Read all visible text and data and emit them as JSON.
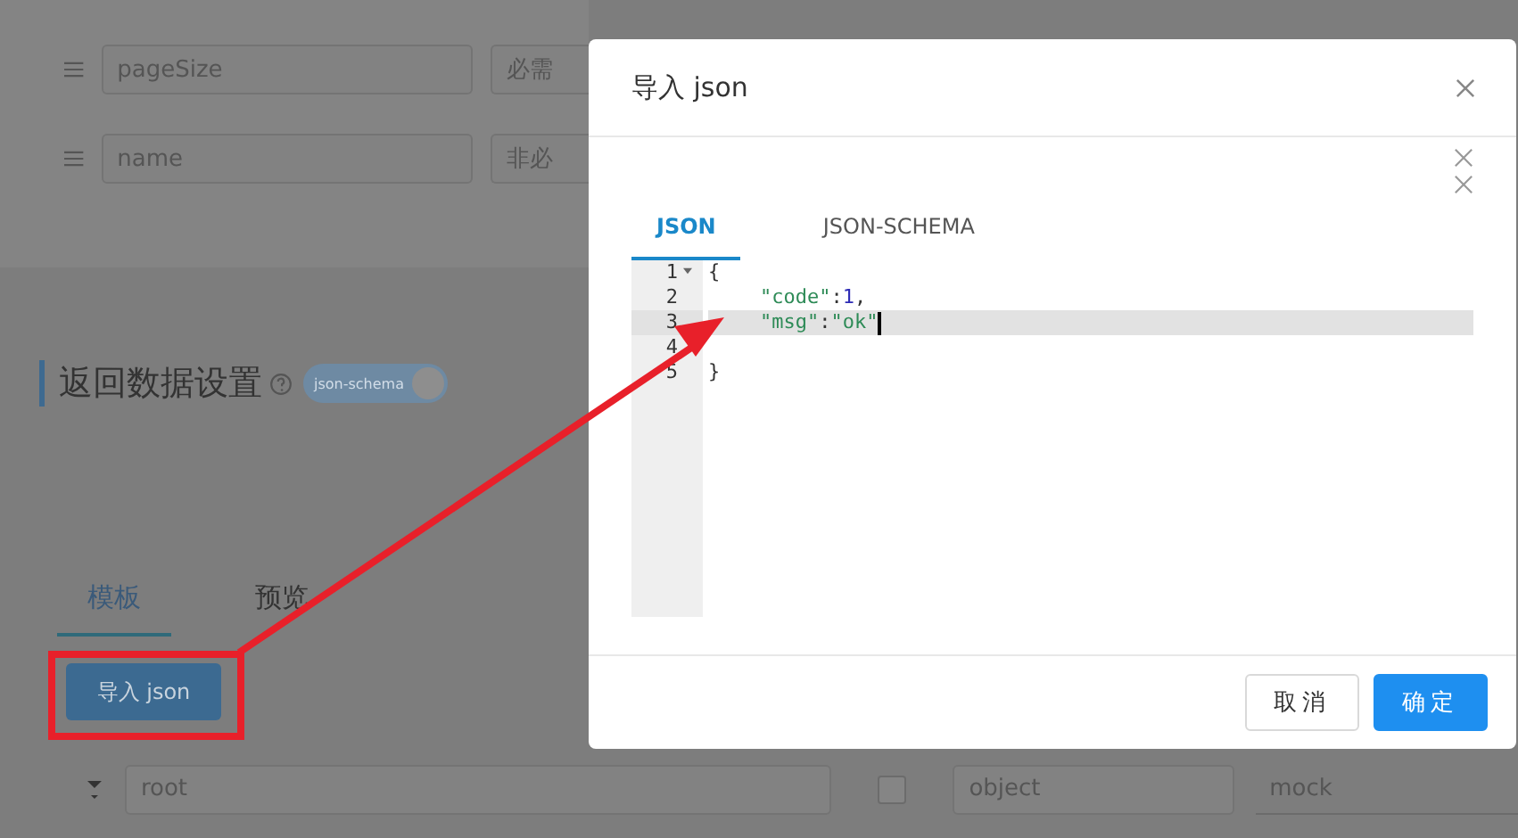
{
  "param_rows": [
    {
      "name": "pageSize",
      "required": "必需"
    },
    {
      "name": "name",
      "required": "非必"
    }
  ],
  "section": {
    "title": "返回数据设置",
    "toggle": {
      "label": "json-schema",
      "on": true
    }
  },
  "tabs": [
    {
      "label": "模板",
      "selected": true
    },
    {
      "label": "预览",
      "selected": false
    }
  ],
  "import_button": "导入 json",
  "schema_row": {
    "name": "root",
    "checked": false,
    "type": "object",
    "mock": "mock"
  },
  "dialog": {
    "title": "导入 json",
    "tabs": [
      {
        "label": "JSON",
        "selected": true
      },
      {
        "label": "JSON-SCHEMA",
        "selected": false
      }
    ],
    "code_lines": [
      {
        "number": "1",
        "fold": true,
        "active": false,
        "indented": false,
        "tokens": [
          {
            "kind": "plain",
            "text": "{"
          }
        ]
      },
      {
        "number": "2",
        "fold": false,
        "active": false,
        "indented": true,
        "tokens": [
          {
            "kind": "string",
            "text": "\"code\""
          },
          {
            "kind": "plain",
            "text": ":"
          },
          {
            "kind": "number",
            "text": "1"
          },
          {
            "kind": "plain",
            "text": ","
          }
        ]
      },
      {
        "number": "3",
        "fold": false,
        "active": true,
        "indented": true,
        "tokens": [
          {
            "kind": "string",
            "text": "\"msg\""
          },
          {
            "kind": "plain",
            "text": ":"
          },
          {
            "kind": "string",
            "text": "\"ok\""
          }
        ]
      },
      {
        "number": "4",
        "fold": false,
        "active": false
      },
      {
        "number": "5",
        "fold": false,
        "active": false,
        "indented": false,
        "tokens": [
          {
            "kind": "plain",
            "text": "}"
          }
        ]
      }
    ],
    "buttons": [
      {
        "label": "取消",
        "kind": "default"
      },
      {
        "label": "确定",
        "kind": "primary"
      }
    ]
  }
}
